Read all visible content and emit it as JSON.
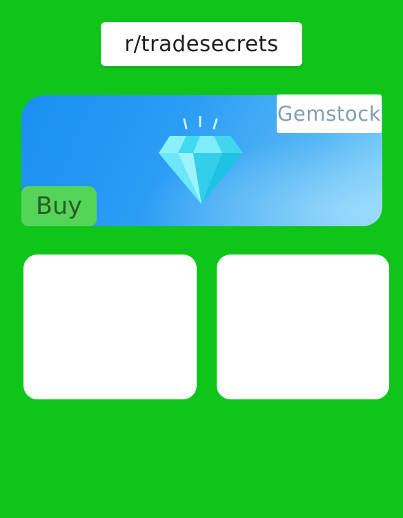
{
  "header": {
    "title": "r/tradesecrets"
  },
  "banner": {
    "brand": "Gemstock",
    "buy_label": "Buy",
    "icon": "diamond-icon"
  },
  "cards": [
    {
      "content": ""
    },
    {
      "content": ""
    }
  ],
  "colors": {
    "background": "#0fc51a",
    "banner_start": "#1b8ff2",
    "banner_end": "#86d2f8",
    "buy_button": "#56d45a",
    "gem": "#2fd5ee"
  }
}
